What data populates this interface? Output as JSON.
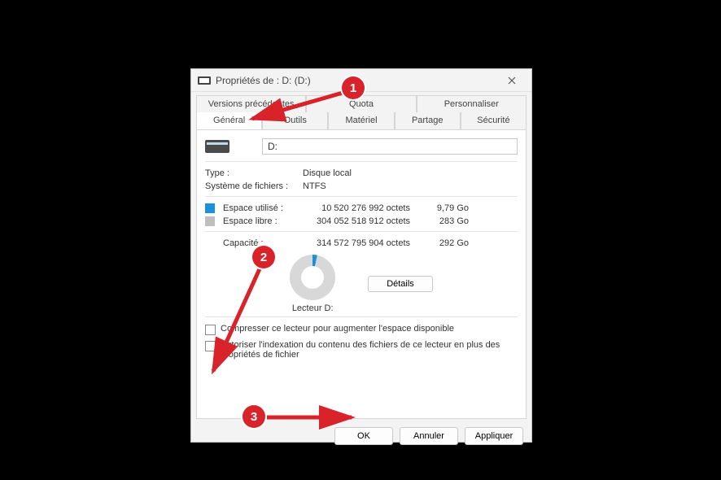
{
  "window": {
    "title": "Propriétés de : D: (D:)"
  },
  "tabs": {
    "row1": [
      "Versions précédentes",
      "Quota",
      "Personnaliser"
    ],
    "row2": [
      "Général",
      "Outils",
      "Matériel",
      "Partage",
      "Sécurité"
    ],
    "active": "Général"
  },
  "drive": {
    "name_value": "D:",
    "type_label": "Type :",
    "type_value": "Disque local",
    "fs_label": "Système de fichiers :",
    "fs_value": "NTFS",
    "used_label": "Espace utilisé :",
    "used_bytes": "10 520 276 992 octets",
    "used_gb": "9,79 Go",
    "free_label": "Espace libre :",
    "free_bytes": "304 052 518 912 octets",
    "free_gb": "283 Go",
    "capacity_label": "Capacité :",
    "capacity_bytes": "314 572 795 904 octets",
    "capacity_gb": "292 Go",
    "chart_label": "Lecteur D:",
    "details_btn": "Détails"
  },
  "checkboxes": {
    "compress": "Compresser ce lecteur pour augmenter l'espace disponible",
    "index": "Autoriser l'indexation du contenu des fichiers de ce lecteur en plus des propriétés de fichier"
  },
  "buttons": {
    "ok": "OK",
    "cancel": "Annuler",
    "apply": "Appliquer"
  },
  "annotations": {
    "n1": "1",
    "n2": "2",
    "n3": "3"
  },
  "chart_data": {
    "type": "pie",
    "title": "Lecteur D:",
    "series": [
      {
        "name": "Espace utilisé",
        "value_gb": 9.79,
        "color": "#1e90d8"
      },
      {
        "name": "Espace libre",
        "value_gb": 283,
        "color": "#d8d8d8"
      }
    ],
    "total_gb": 292
  }
}
